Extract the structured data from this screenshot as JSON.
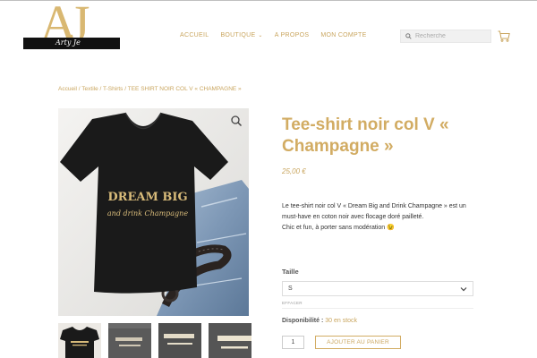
{
  "logo": {
    "initials": "AJ",
    "script": "Arty Je"
  },
  "nav": {
    "items": [
      {
        "label": "ACCUEIL"
      },
      {
        "label": "BOUTIQUE",
        "has_dropdown": true
      },
      {
        "label": "A PROPOS"
      },
      {
        "label": "MON COMPTE"
      }
    ]
  },
  "search": {
    "placeholder": "Recherche"
  },
  "breadcrumb": {
    "items": [
      "Accueil",
      "Textile",
      "T-Shirts",
      "TEE SHIRT NOIR COL V « CHAMPAGNE »"
    ],
    "separator": " / "
  },
  "product": {
    "title": "Tee-shirt noir col V « Champagne »",
    "price": "25,00 €",
    "description_lines": [
      "Le tee-shirt noir col V « Dream Big and Drink Champagne » est un",
      "must-have en coton noir avec flocage doré pailleté.",
      "Chic et fun, à porter sans modération 😉"
    ],
    "shirt_text_1": "DREAM BIG",
    "shirt_text_2": "and drink Champagne",
    "size_label": "Taille",
    "size_value": "S",
    "clear_label": "EFFACER",
    "availability_label": "Disponibilité :",
    "availability_value": "30 en stock",
    "quantity": "1",
    "add_to_cart_label": "AJOUTER AU PANIER"
  },
  "colors": {
    "accent": "#d2ac63",
    "nav_gold": "#c9a55e",
    "shirt": "#1a1a1a",
    "denim": "#7e98b6"
  },
  "icons": [
    "search-icon",
    "cart-icon",
    "zoom-icon",
    "chevron-down-icon"
  ]
}
